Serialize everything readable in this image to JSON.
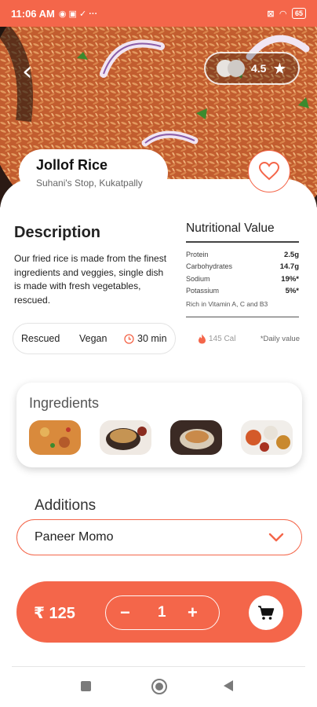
{
  "status_bar": {
    "time": "11:06 AM",
    "battery": "65"
  },
  "dish": {
    "name": "Jollof Rice",
    "restaurant": "Suhani's Stop, Kukatpally",
    "rating": "4.5"
  },
  "description": {
    "title": "Description",
    "text": "Our fried rice is made from the finest ingredients and veggies, single dish is made with fresh vegetables, rescued."
  },
  "tags": {
    "tag1": "Rescued",
    "tag2": "Vegan",
    "time": "30 min"
  },
  "nutrition": {
    "title": "Nutritional Value",
    "rows": [
      {
        "label": "Protein",
        "value": "2.5g"
      },
      {
        "label": "Carbohydrates",
        "value": "14.7g"
      },
      {
        "label": "Sodium",
        "value": "19%*"
      },
      {
        "label": "Potassium",
        "value": "5%*"
      }
    ],
    "rich_in": "Rich in Vitamin A, C and B3",
    "calories": "145 Cal",
    "daily_note": "*Daily value"
  },
  "ingredients": {
    "label": "Ingredients"
  },
  "additions": {
    "label": "Additions",
    "selected": "Paneer Momo"
  },
  "cart": {
    "price": "₹ 125",
    "minus": "−",
    "quantity": "1",
    "plus": "+"
  },
  "icons": {
    "back": "chevron-left-icon",
    "rating": "star-icon",
    "favorite": "heart-icon",
    "time": "clock-icon",
    "calories": "flame-icon",
    "dropdown": "chevron-down-icon",
    "cart": "cart-icon"
  },
  "colors": {
    "accent": "#f4664a",
    "text": "#222222"
  }
}
